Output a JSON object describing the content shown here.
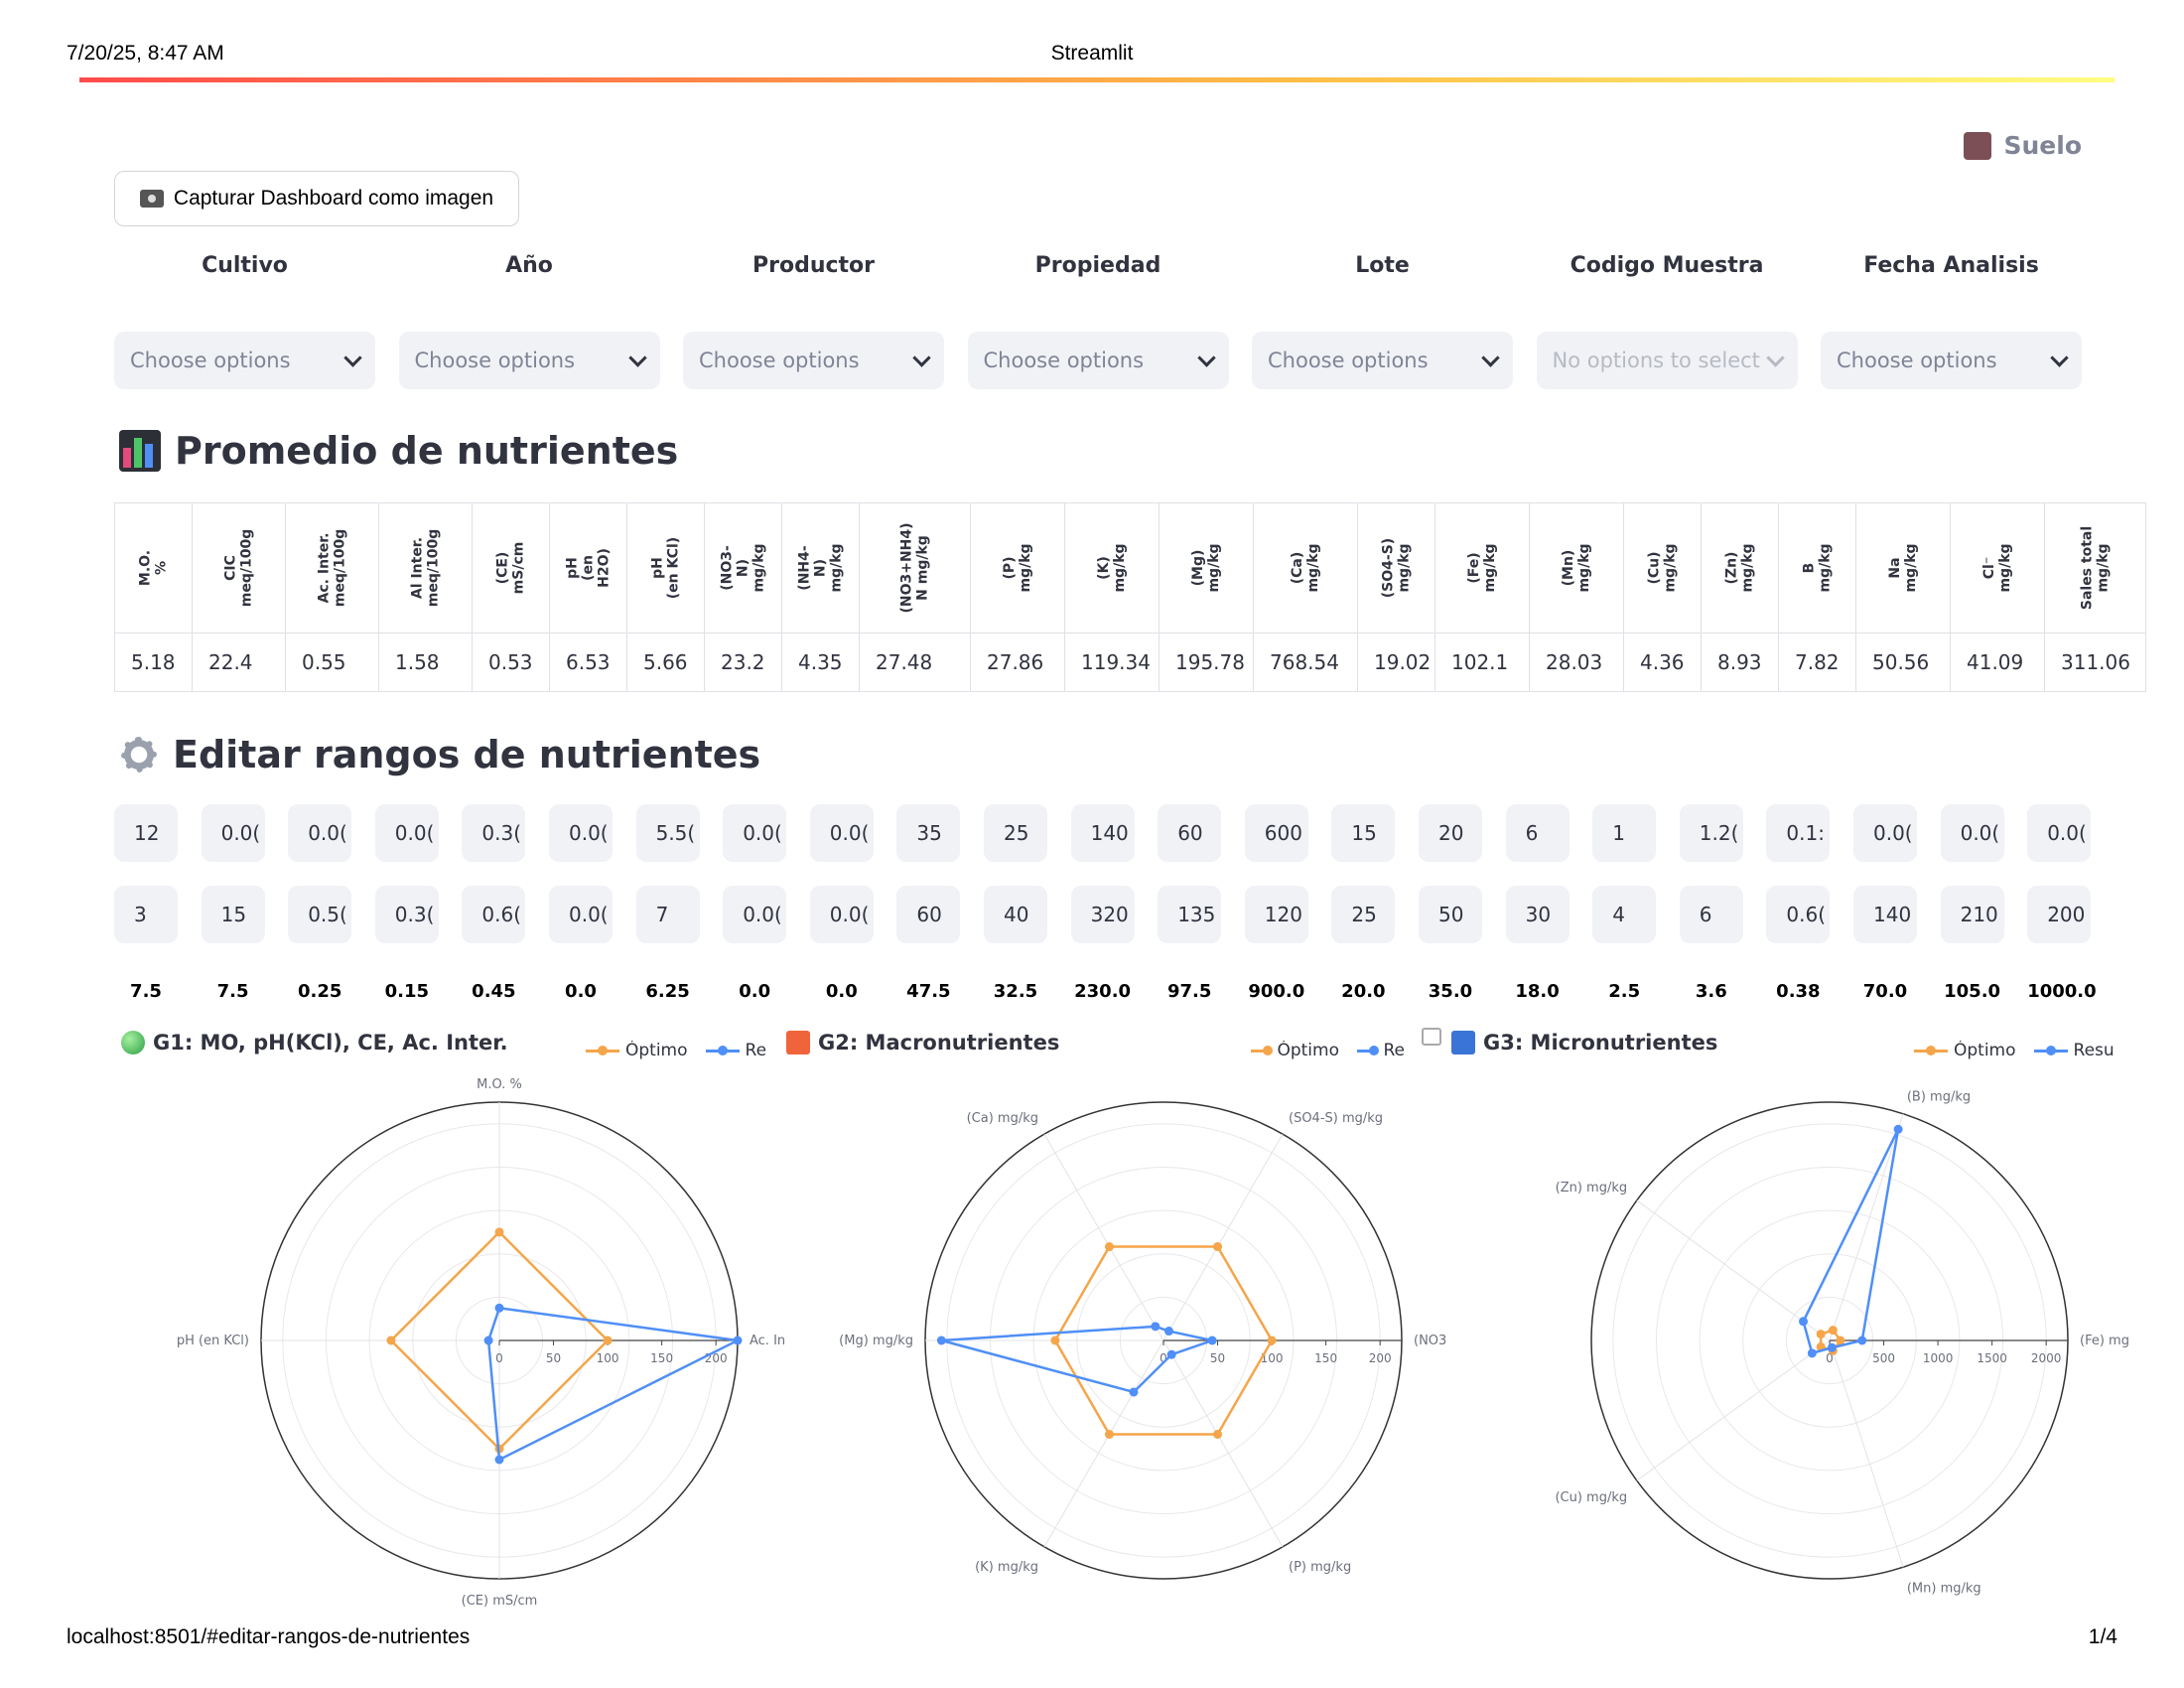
{
  "print": {
    "date": "7/20/25, 8:47 AM",
    "title": "Streamlit",
    "url": "localhost:8501/#editar-rangos-de-nutrientes",
    "page": "1/4"
  },
  "page_badge": "Suelo",
  "capture_button": "Capturar Dashboard como imagen",
  "filters": [
    {
      "label": "Cultivo",
      "placeholder": "Choose options",
      "disabled": false
    },
    {
      "label": "Año",
      "placeholder": "Choose options",
      "disabled": false
    },
    {
      "label": "Productor",
      "placeholder": "Choose options",
      "disabled": false
    },
    {
      "label": "Propiedad",
      "placeholder": "Choose options",
      "disabled": false
    },
    {
      "label": "Lote",
      "placeholder": "Choose options",
      "disabled": false
    },
    {
      "label": "Codigo Muestra",
      "placeholder": "No options to select",
      "disabled": true
    },
    {
      "label": "Fecha Analisis",
      "placeholder": "Choose options",
      "disabled": false
    }
  ],
  "section_avg_title": "Promedio de nutrientes",
  "section_edit_title": "Editar rangos de nutrientes",
  "table": {
    "headers": [
      "M.O.\n%",
      "CIC\nmeq/100g",
      "Ac. Inter.\nmeq/100g",
      "Al Inter.\nmeq/100g",
      "(CE)\nmS/cm",
      "pH\n(en\nH2O)",
      "pH\n(en KCl)",
      "(NO3-\nN)\nmg/kg",
      "(NH4-\nN)\nmg/kg",
      "(NO3+NH4)\nN mg/kg",
      "(P)\nmg/kg",
      "(K)\nmg/kg",
      "(Mg)\nmg/kg",
      "(Ca)\nmg/kg",
      "(SO4-S)\nmg/kg",
      "(Fe)\nmg/kg",
      "(Mn)\nmg/kg",
      "(Cu)\nmg/kg",
      "(Zn)\nmg/kg",
      "B\nmg/kg",
      "Na\nmg/kg",
      "Cl⁻\nmg/kg",
      "Sales total\nmg/kg"
    ],
    "values": [
      "5.18",
      "22.4",
      "0.55",
      "1.58",
      "0.53",
      "6.53",
      "5.66",
      "23.2",
      "4.35",
      "27.48",
      "27.86",
      "119.34",
      "195.78",
      "768.54",
      "19.02",
      "102.1",
      "28.03",
      "4.36",
      "8.93",
      "7.82",
      "50.56",
      "41.09",
      "311.06"
    ]
  },
  "range_min": [
    "12",
    "0.0(",
    "0.0(",
    "0.0(",
    "0.3(",
    "0.0(",
    "5.5(",
    "0.0(",
    "0.0(",
    "35",
    "25",
    "140",
    "60",
    "600",
    "15",
    "20",
    "6",
    "1",
    "1.2(",
    "0.1:",
    "0.0(",
    "0.0(",
    "0.0("
  ],
  "range_max": [
    "3",
    "15",
    "0.5(",
    "0.3(",
    "0.6(",
    "0.0(",
    "7",
    "0.0(",
    "0.0(",
    "60",
    "40",
    "320",
    "135",
    "120",
    "25",
    "50",
    "30",
    "4",
    "6",
    "0.6(",
    "140",
    "210",
    "200"
  ],
  "range_avg": [
    "7.5",
    "7.5",
    "0.25",
    "0.15",
    "0.45",
    "0.0",
    "6.25",
    "0.0",
    "0.0",
    "47.5",
    "32.5",
    "230.0",
    "97.5",
    "900.0",
    "20.0",
    "35.0",
    "18.0",
    "2.5",
    "3.6",
    "0.38",
    "70.0",
    "105.0",
    "1000.0"
  ],
  "charts_meta": {
    "legend_opt": "Óptimo",
    "legend_res_g1": "Re",
    "legend_res_g2": "Re",
    "legend_res_g3": "Resu",
    "colors": {
      "optimo": "#f5a54a",
      "resultado": "#4f8ff7"
    }
  },
  "chart_data": [
    {
      "type": "radar",
      "title": "G1: MO, pH(KCl), CE, Ac. Inter.",
      "axes": [
        "M.O. %",
        "Ac. In",
        "(CE) mS/cm",
        "pH  (en KCl)"
      ],
      "radial_ticks": [
        "0",
        "50",
        "100",
        "150",
        "200"
      ],
      "rmax": 200,
      "series": [
        {
          "name": "Óptimo",
          "values": [
            100,
            100,
            100,
            100
          ]
        },
        {
          "name": "Re",
          "values": [
            30,
            220,
            110,
            10
          ]
        }
      ]
    },
    {
      "type": "radar",
      "title": "G2: Macronutrientes",
      "axes": [
        "(NO3",
        "(SO4-S) mg/kg",
        "(Ca) mg/kg",
        "(Mg) mg/kg",
        "(K) mg/kg",
        "(P) mg/kg"
      ],
      "radial_ticks": [
        "0",
        "50",
        "100",
        "150",
        "200"
      ],
      "rmax": 200,
      "series": [
        {
          "name": "Óptimo",
          "values": [
            100,
            100,
            100,
            100,
            100,
            100
          ]
        },
        {
          "name": "Re",
          "values": [
            45,
            10,
            15,
            205,
            55,
            15
          ]
        }
      ]
    },
    {
      "type": "radar",
      "title": "G3: Micronutrientes",
      "axes": [
        "(Fe) mg",
        "(B)  mg/kg",
        "(Zn)  mg/kg",
        "(Cu) mg/kg",
        "(Mn) mg/kg"
      ],
      "radial_ticks": [
        "0",
        "500",
        "1000",
        "1500",
        "2000"
      ],
      "rmax": 2000,
      "series": [
        {
          "name": "Óptimo",
          "values": [
            100,
            100,
            100,
            100,
            100
          ]
        },
        {
          "name": "Resu",
          "values": [
            300,
            2050,
            300,
            200,
            70
          ]
        }
      ]
    }
  ]
}
